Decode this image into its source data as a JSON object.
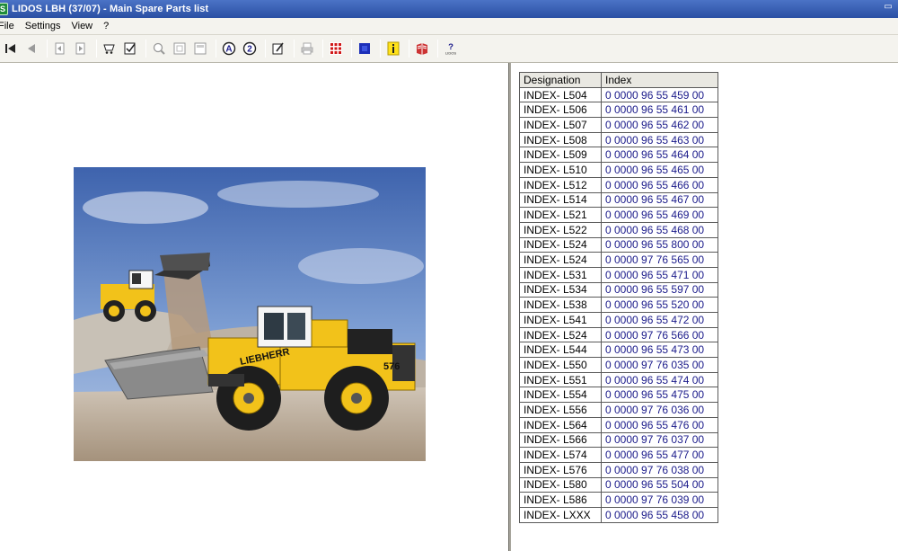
{
  "window": {
    "title": "LIDOS LBH  (37/07) - Main Spare Parts list",
    "app_icon_letter": "S"
  },
  "menu": {
    "items": [
      "File",
      "Settings",
      "View",
      "?"
    ]
  },
  "toolbar": {
    "buttons": [
      "first-record-icon",
      "previous-record-icon",
      "back-page-icon",
      "forward-page-icon",
      "cart-icon",
      "checklist-icon",
      "zoom-in-icon",
      "page-icon",
      "page-view-icon",
      "circle-a-icon",
      "circle-2-icon",
      "edit-icon",
      "print-icon",
      "grid-icon",
      "blue-square-icon",
      "info-icon",
      "book-icon",
      "lidos-help-icon"
    ],
    "lidos_help_label": "LIDOS"
  },
  "photo": {
    "brand_text": "LIEBHERR",
    "model_text": "576",
    "colors": {
      "machine_yellow": "#f2c21a",
      "sky": "#5e86c6",
      "gravel": "#c9bfb0"
    }
  },
  "table": {
    "headers": [
      "Designation",
      "Index"
    ],
    "rows": [
      [
        "INDEX- L504",
        "0 0000  96 55 459 00"
      ],
      [
        "INDEX- L506",
        "0 0000  96 55 461 00"
      ],
      [
        "INDEX- L507",
        "0 0000  96 55 462 00"
      ],
      [
        "INDEX- L508",
        "0 0000  96 55 463 00"
      ],
      [
        "INDEX- L509",
        "0 0000  96 55 464 00"
      ],
      [
        "INDEX- L510",
        "0 0000  96 55 465 00"
      ],
      [
        "INDEX- L512",
        "0 0000  96 55 466 00"
      ],
      [
        "INDEX- L514",
        "0 0000  96 55 467 00"
      ],
      [
        "INDEX- L521",
        "0 0000  96 55 469 00"
      ],
      [
        "INDEX- L522",
        "0 0000  96 55 468 00"
      ],
      [
        "INDEX- L524",
        "0 0000  96 55 800 00"
      ],
      [
        "INDEX- L524",
        "0 0000  97 76 565 00"
      ],
      [
        "INDEX- L531",
        "0 0000  96 55 471 00"
      ],
      [
        "INDEX- L534",
        "0 0000  96 55 597 00"
      ],
      [
        "INDEX- L538",
        "0 0000  96 55 520 00"
      ],
      [
        "INDEX- L541",
        "0 0000  96 55 472 00"
      ],
      [
        "INDEX- L524",
        "0 0000  97 76 566 00"
      ],
      [
        "INDEX- L544",
        "0 0000  96 55 473 00"
      ],
      [
        "INDEX- L550",
        "0 0000  97 76 035 00"
      ],
      [
        "INDEX- L551",
        "0 0000  96 55 474 00"
      ],
      [
        "INDEX- L554",
        "0 0000  96 55 475 00"
      ],
      [
        "INDEX- L556",
        "0 0000  97 76 036 00"
      ],
      [
        "INDEX- L564",
        "0 0000  96 55 476 00"
      ],
      [
        "INDEX- L566",
        "0 0000  97 76 037 00"
      ],
      [
        "INDEX- L574",
        "0 0000  96 55 477 00"
      ],
      [
        "INDEX- L576",
        "0 0000  97 76 038 00"
      ],
      [
        "INDEX- L580",
        "0 0000  96 55 504 00"
      ],
      [
        "INDEX- L586",
        "0 0000  97 76 039 00"
      ],
      [
        "INDEX- LXXX",
        "0 0000  96 55 458 00"
      ]
    ]
  }
}
